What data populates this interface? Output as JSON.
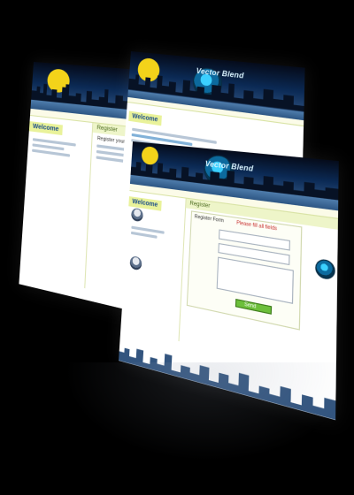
{
  "pages": {
    "back_left": {
      "sidebar_title": "Welcome",
      "main_title": "Register",
      "main_line": "Register your account"
    },
    "back_right": {
      "sidebar_title": "Welcome",
      "logo_text": "Vector Blend"
    },
    "front": {
      "sidebar_title": "Welcome",
      "main_title": "Register",
      "logo_text": "Vector Blend",
      "form_label": "Register Form",
      "error_text": "Please fill all fields",
      "send_label": "Send"
    }
  },
  "colors": {
    "accent_yellow": "#f3d31a",
    "sky_navy": "#0b2a55",
    "nav_blue": "#2d5684",
    "sidebar_lime": "#e9f29a",
    "button_green": "#6cbf3a"
  }
}
